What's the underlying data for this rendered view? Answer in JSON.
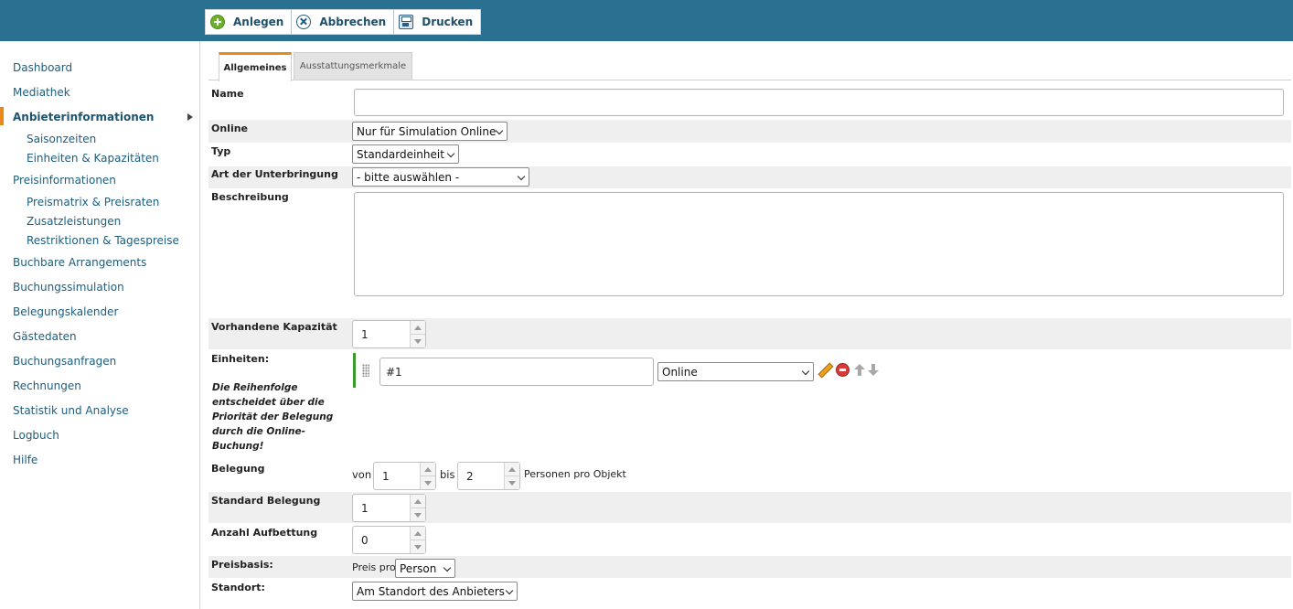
{
  "toolbar": {
    "create_label": "Anlegen",
    "cancel_label": "Abbrechen",
    "print_label": "Drucken"
  },
  "sidebar": {
    "items": [
      {
        "label": "Dashboard"
      },
      {
        "label": "Mediathek"
      },
      {
        "label": "Anbieterinformationen",
        "active": true
      },
      {
        "label": "Saisonzeiten"
      },
      {
        "label": "Einheiten & Kapazitäten"
      },
      {
        "label": "Preisinformationen"
      },
      {
        "label": "Preismatrix & Preisraten"
      },
      {
        "label": "Zusatzleistungen"
      },
      {
        "label": "Restriktionen & Tagespreise"
      },
      {
        "label": "Buchbare Arrangements"
      },
      {
        "label": "Buchungssimulation"
      },
      {
        "label": "Belegungskalender"
      },
      {
        "label": "Gästedaten"
      },
      {
        "label": "Buchungsanfragen"
      },
      {
        "label": "Rechnungen"
      },
      {
        "label": "Statistik und Analyse"
      },
      {
        "label": "Logbuch"
      },
      {
        "label": "Hilfe"
      }
    ]
  },
  "tabs": {
    "general": "Allgemeines",
    "features": "Ausstattungsmerkmale"
  },
  "form": {
    "name": {
      "label": "Name",
      "value": ""
    },
    "online": {
      "label": "Online",
      "value": "Nur für Simulation Online"
    },
    "type": {
      "label": "Typ",
      "value": "Standardeinheit"
    },
    "accommodation": {
      "label": "Art der Unterbringung",
      "value": "- bitte auswählen -"
    },
    "description": {
      "label": "Beschreibung",
      "value": ""
    },
    "capacity": {
      "label": "Vorhandene Kapazität",
      "value": "1"
    },
    "units": {
      "label": "Einheiten:",
      "hint": "Die Reihenfolge entscheidet über die Priorität der Belegung durch die Online-Buchung!",
      "unit_name": "#1",
      "unit_status": "Online"
    },
    "occupancy": {
      "label": "Belegung",
      "from_label": "von",
      "from_value": "1",
      "to_label": "bis",
      "to_value": "2",
      "suffix": "Personen pro Objekt"
    },
    "standard_occupancy": {
      "label": "Standard Belegung",
      "value": "1"
    },
    "extra_beds": {
      "label": "Anzahl Aufbettung",
      "value": "0"
    },
    "price_basis": {
      "label": "Preisbasis:",
      "prefix": "Preis pro",
      "value": "Person"
    },
    "location": {
      "label": "Standort:",
      "value": "Am Standort des Anbieters"
    }
  }
}
